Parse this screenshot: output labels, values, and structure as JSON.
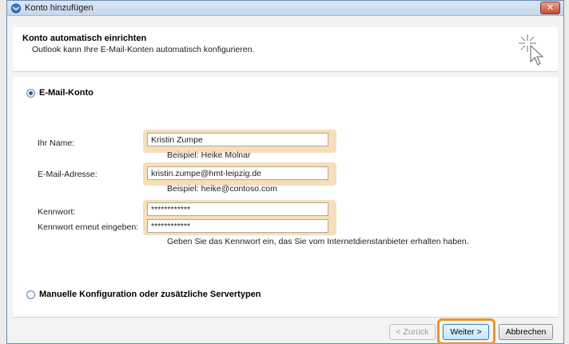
{
  "window": {
    "title": "Konto hinzufügen",
    "close_label": "✕"
  },
  "header": {
    "title": "Konto automatisch einrichten",
    "subtitle": "Outlook kann Ihre E-Mail-Konten automatisch konfigurieren."
  },
  "options": {
    "email_account": {
      "label": "E-Mail-Konto",
      "selected": true
    },
    "manual": {
      "label": "Manuelle Konfiguration oder zusätzliche Servertypen",
      "selected": false
    }
  },
  "form": {
    "name": {
      "label": "Ihr Name:",
      "value": "Kristin Zumpe",
      "hint": "Beispiel: Heike Molnar"
    },
    "email": {
      "label": "E-Mail-Adresse:",
      "value": "kristin.zumpe@hmt-leipzig.de",
      "hint": "Beispiel: heike@contoso.com"
    },
    "password": {
      "label": "Kennwort:",
      "value": "************"
    },
    "password_confirm": {
      "label": "Kennwort erneut eingeben:",
      "value": "************"
    },
    "password_hint": "Geben Sie das Kennwort ein, das Sie vom Internetdienstanbieter erhalten haben."
  },
  "buttons": {
    "back": "< Zurück",
    "next": "Weiter >",
    "cancel": "Abbrechen"
  },
  "colors": {
    "highlight": "#f6deb8",
    "focus_ring": "#e8962b",
    "title_bar": "#c5d7ec"
  }
}
